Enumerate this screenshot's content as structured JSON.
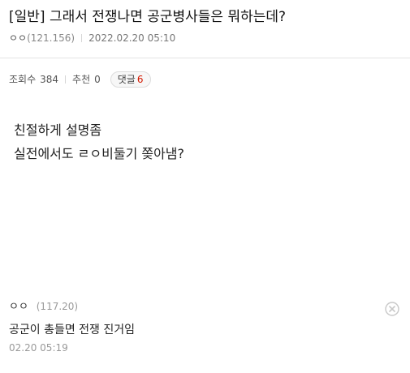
{
  "post": {
    "title": "[일반] 그래서 전쟁나면 공군병사들은 뭐하는데?",
    "author": "ㅇㅇ",
    "author_id": "(121.156)",
    "date": "2022.02.20 05:10",
    "views_label": "조회수",
    "views": "384",
    "recommend_label": "추천",
    "recommend": "0",
    "comments_label": "댓글",
    "comments": "6",
    "body_lines": [
      "친절하게 설명좀",
      "실전에서도 ㄹㅇ비둘기 쫒아냄?"
    ]
  },
  "comments": [
    {
      "author": "ㅇㅇ",
      "author_id": "(117.20)",
      "text": "공군이 총들면 전쟁 진거임",
      "date": "02.20 05:19",
      "delete_icon": "close-circle-icon"
    }
  ],
  "colors": {
    "comment_count": "#d31900",
    "meta_text": "#777777",
    "divider": "#e4e4e4"
  }
}
